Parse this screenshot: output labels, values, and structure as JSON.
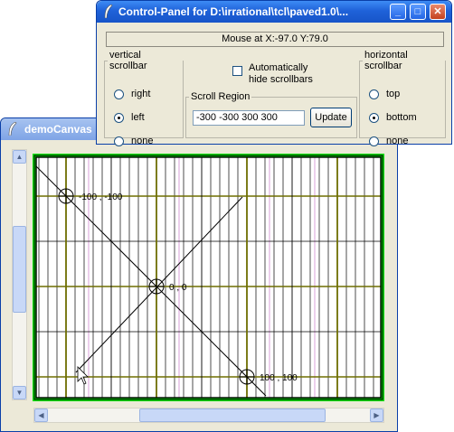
{
  "demo_window": {
    "title": "demoCanvas"
  },
  "control_panel": {
    "title": "Control-Panel for D:\\irrational\\tcl\\paved1.0\\...",
    "status_label": "Mouse at",
    "status_coords": "X:-97.0  Y:79.0",
    "vertical_group": {
      "legend": "vertical scrollbar",
      "options": [
        "right",
        "left",
        "none"
      ],
      "selected": "left"
    },
    "auto_hide": {
      "line1": "Automatically",
      "line2": "hide scrollbars",
      "checked": false
    },
    "scroll_region": {
      "legend": "Scroll Region",
      "value": "-300 -300 300 300",
      "button": "Update"
    },
    "horizontal_group": {
      "legend": "horizontal scrollbar",
      "options": [
        "top",
        "bottom",
        "none"
      ],
      "selected": "bottom"
    }
  },
  "canvas": {
    "labels": [
      "-100 , -100",
      "0 , 0",
      "100 , 100"
    ],
    "colors": {
      "border": "#00e000",
      "major_grid": "#6e6e00",
      "minor_grid": "#000000",
      "diag_grid": "#c060c0",
      "crosshair": "#000000"
    }
  }
}
